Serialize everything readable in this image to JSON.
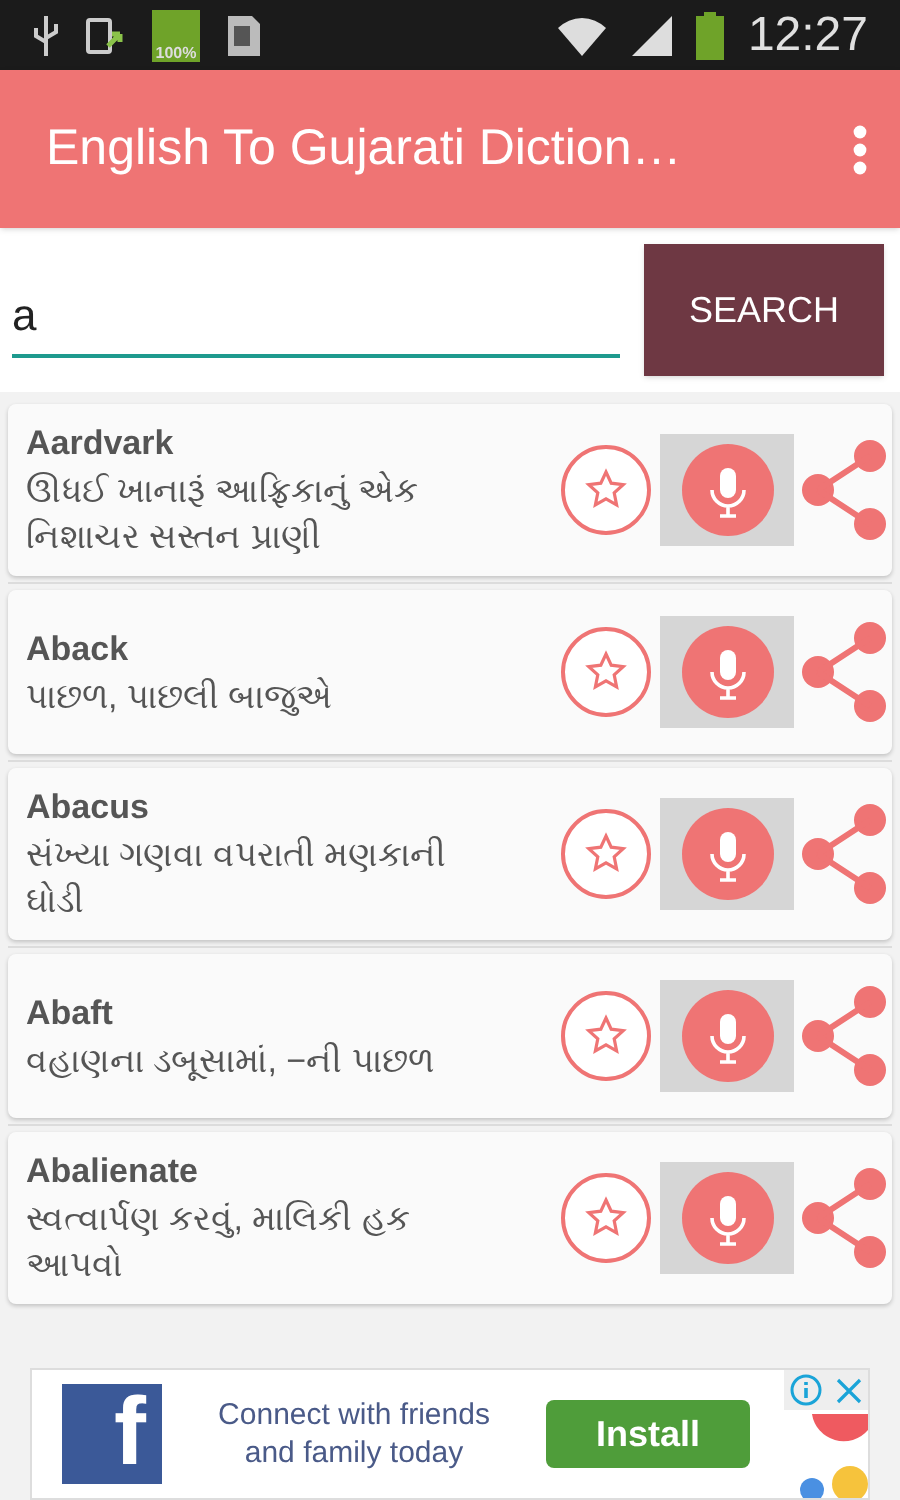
{
  "status_bar": {
    "battery_label": "100%",
    "time": "12:27"
  },
  "app_bar": {
    "title": "English To Gujarati Diction…"
  },
  "search": {
    "value": "a",
    "button": "SEARCH"
  },
  "results": [
    {
      "word": "Aardvark",
      "meaning": "ઊધઈ ખાનારૂં આફ્રિકાનું એક નિશાચર સસ્તન પ્રાણી"
    },
    {
      "word": "Aback",
      "meaning": "પાછળ, પાછલી બાજુએ"
    },
    {
      "word": "Abacus",
      "meaning": "સંખ્યા ગણવા વપરાતી મણકાની ઘોડી"
    },
    {
      "word": "Abaft",
      "meaning": "વહાણના ડબૂસામાં, −ની પાછળ"
    },
    {
      "word": "Abalienate",
      "meaning": "સ્વત્વાર્પણ કરવું, માલિકી હક આપવો"
    }
  ],
  "ad": {
    "logo_letter": "f",
    "text": "Connect with friends and family today",
    "button": "Install"
  }
}
